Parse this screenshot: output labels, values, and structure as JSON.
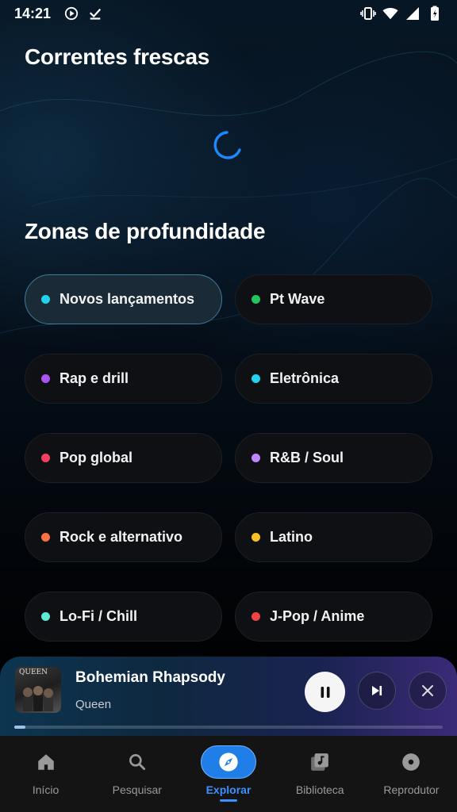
{
  "status_bar": {
    "time": "14:21",
    "left_icons": [
      "play-circle-icon",
      "download-done-icon"
    ],
    "right_icons": [
      "vibrate-icon",
      "wifi-icon",
      "signal-icon",
      "battery-charging-icon"
    ]
  },
  "sections": {
    "fresh_title": "Correntes frescas",
    "zones_title": "Zonas de profundidade"
  },
  "zones": [
    {
      "label": "Novos lançamentos",
      "dot_color": "#22d3ee",
      "selected": true
    },
    {
      "label": "Pt Wave",
      "dot_color": "#22c55e",
      "selected": false
    },
    {
      "label": "Rap e drill",
      "dot_color": "#a855f7",
      "selected": false
    },
    {
      "label": "Eletrônica",
      "dot_color": "#22d3ee",
      "selected": false
    },
    {
      "label": "Pop global",
      "dot_color": "#f43f5e",
      "selected": false
    },
    {
      "label": "R&B / Soul",
      "dot_color": "#c084fc",
      "selected": false
    },
    {
      "label": "Rock e alternativo",
      "dot_color": "#fb7141",
      "selected": false
    },
    {
      "label": "Latino",
      "dot_color": "#fbbf24",
      "selected": false
    },
    {
      "label": "Lo-Fi / Chill",
      "dot_color": "#5eead4",
      "selected": false
    },
    {
      "label": "J-Pop / Anime",
      "dot_color": "#ef4444",
      "selected": false
    }
  ],
  "player": {
    "cover_text": "QUEEN",
    "title": "Bohemian Rhapsody",
    "artist": "Queen",
    "progress": 0.025
  },
  "nav": {
    "items": [
      {
        "label": "Início",
        "icon": "home-icon",
        "active": false
      },
      {
        "label": "Pesquisar",
        "icon": "search-icon",
        "active": false
      },
      {
        "label": "Explorar",
        "icon": "compass-icon",
        "active": true
      },
      {
        "label": "Biblioteca",
        "icon": "library-icon",
        "active": false
      },
      {
        "label": "Reprodutor",
        "icon": "disc-icon",
        "active": false
      }
    ]
  },
  "colors": {
    "accent": "#1f7ee8",
    "spinner": "#1e88ff"
  }
}
